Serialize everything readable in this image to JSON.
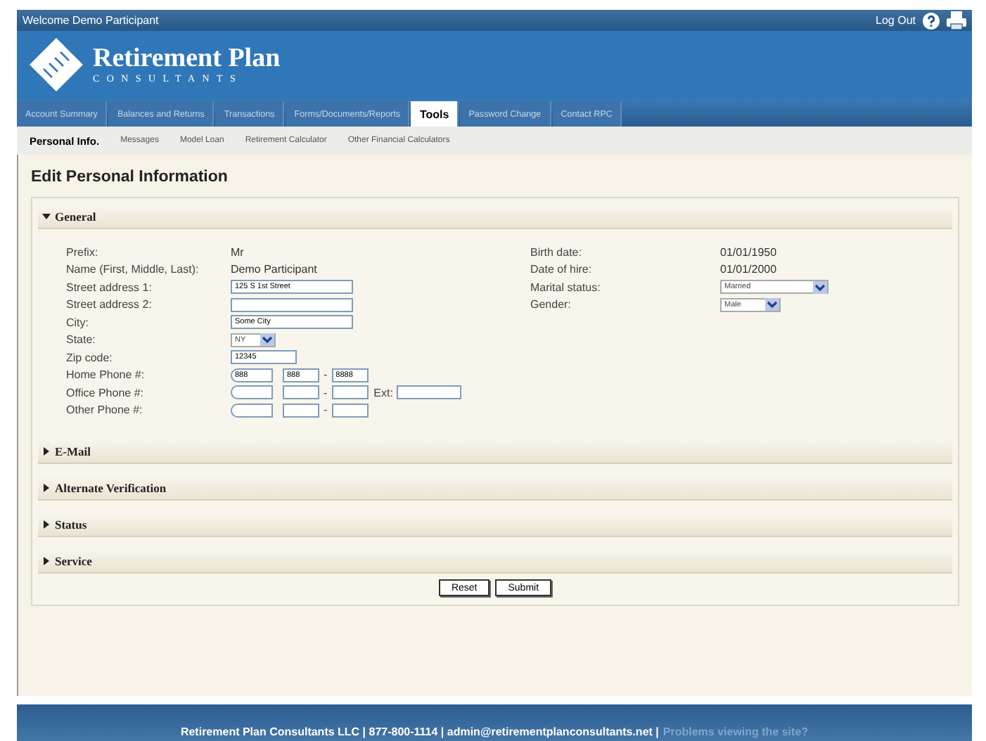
{
  "header": {
    "welcome": "Welcome  Demo Participant",
    "logout": "Log Out"
  },
  "logo": {
    "title": "Retirement Plan",
    "subtitle": "CONSULTANTS"
  },
  "tabs": [
    {
      "label": "Account Summary",
      "selected": false
    },
    {
      "label": "Balances and Returns",
      "selected": false
    },
    {
      "label": "Transactions",
      "selected": false
    },
    {
      "label": "Forms/Documents/Reports",
      "selected": false
    },
    {
      "label": "Tools",
      "selected": true
    },
    {
      "label": "Password Change",
      "selected": false
    },
    {
      "label": "Contact RPC",
      "selected": false
    }
  ],
  "subnav": [
    {
      "label": "Personal Info.",
      "selected": true
    },
    {
      "label": "Messages",
      "selected": false
    },
    {
      "label": "Model Loan",
      "selected": false
    },
    {
      "label": "Retirement Calculator",
      "selected": false
    },
    {
      "label": "Other Financial Calculators",
      "selected": false
    }
  ],
  "page_title": "Edit Personal Information",
  "sections": [
    {
      "title": "General",
      "expanded": true
    },
    {
      "title": "E-Mail",
      "expanded": false
    },
    {
      "title": "Alternate Verification",
      "expanded": false
    },
    {
      "title": "Status",
      "expanded": false
    },
    {
      "title": "Service",
      "expanded": false
    }
  ],
  "general_left": [
    {
      "label": "Prefix:",
      "kind": "text",
      "value": "Mr"
    },
    {
      "label": "Name (First, Middle, Last):",
      "kind": "text",
      "value": "Demo Participant"
    },
    {
      "label": "Street address 1:",
      "kind": "input",
      "value": "125 S 1st Street"
    },
    {
      "label": "Street address 2:",
      "kind": "input"
    },
    {
      "label": "City:",
      "kind": "input",
      "value": "Some City"
    },
    {
      "label": "State:",
      "kind": "select",
      "value": "NY"
    },
    {
      "label": "Zip code:",
      "kind": "zip",
      "value": "12345"
    },
    {
      "label": "Home Phone #:",
      "kind": "phone",
      "area": "888",
      "prefix": "888",
      "separator": "-",
      "line": "8888"
    },
    {
      "label": "Office Phone #:",
      "kind": "phone",
      "separator": "-",
      "ext_label": "Ext:"
    },
    {
      "label": "Other Phone #:",
      "kind": "phone",
      "separator": "-"
    }
  ],
  "general_right": [
    {
      "label": "Birth date:",
      "kind": "text",
      "value": "01/01/1950"
    },
    {
      "label": "Date of hire:",
      "kind": "text",
      "value": "01/01/2000"
    },
    {
      "label": "Marital status:",
      "kind": "select",
      "value": "Married"
    },
    {
      "label": "Gender:",
      "kind": "select",
      "value": "Male"
    }
  ],
  "buttons": [
    "Reset",
    "Submit"
  ],
  "footer": {
    "text": "Retirement Plan Consultants LLC | 877-800-1114 | admin@retirementplanconsultants.net |",
    "link": "Problems viewing the site?"
  }
}
